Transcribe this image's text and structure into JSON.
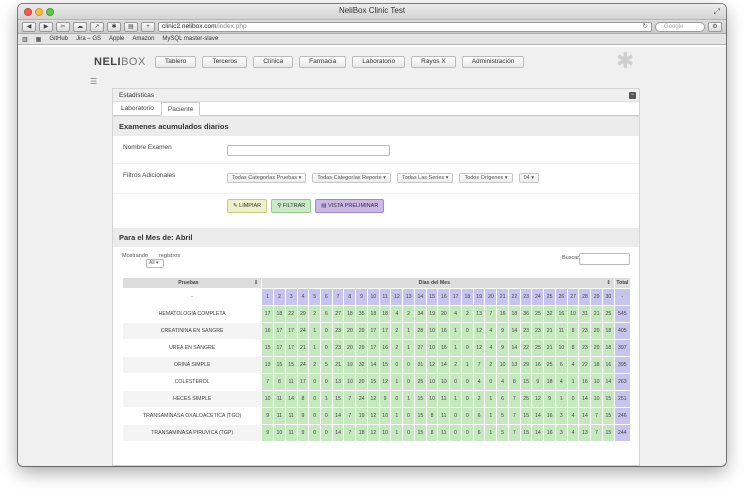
{
  "browser": {
    "window_title": "NeliBox Clinic Test",
    "url_host": "clinic2.nelibox.com",
    "url_path": "/index.php",
    "search_placeholder": "Google",
    "bookmarks": [
      "GitHub",
      "Jira – GS",
      "Apple",
      "Amazon",
      "MySQL master-slave"
    ]
  },
  "app": {
    "logo_main": "NELI",
    "logo_sub": "BOX",
    "nav": [
      "Tablero",
      "Terceros",
      "Clínica",
      "Farmacia",
      "Laboratorio",
      "Rayos X",
      "Administración"
    ]
  },
  "panel": {
    "title": "Estadísticas",
    "tabs": [
      "Laboratorio",
      "Paciente"
    ]
  },
  "form": {
    "section_title": "Examenes acumulados diarios",
    "exam_label": "Nombre Examen",
    "filters_label": "Filtros Adicionales",
    "filters": [
      "Todas Categorías Pruebas",
      "Todas Categorías Reporte",
      "Todas Las Series",
      "Todos Orígenes",
      "04"
    ],
    "btn_clear": "LIMPIAR",
    "btn_filter": "FILTRAR",
    "btn_preview": "VISTA PRELIMINAR"
  },
  "report": {
    "month_title": "Para el Mes de: Abril",
    "show_label": "Mostrando",
    "records_label": "registros",
    "page_len": "All",
    "search_label": "Buscar:",
    "col_tests": "Pruebas",
    "col_days": "Días del Mes",
    "col_total": "Total",
    "days": [
      "1",
      "2",
      "3",
      "4",
      "5",
      "6",
      "7",
      "8",
      "9",
      "10",
      "11",
      "12",
      "13",
      "14",
      "15",
      "16",
      "17",
      "18",
      "19",
      "20",
      "21",
      "22",
      "23",
      "24",
      "25",
      "26",
      "27",
      "28",
      "29",
      "30"
    ],
    "header_row_label": "-",
    "header_row_total": "-",
    "rows": [
      {
        "name": "HEMATOLOGIA COMPLETA",
        "vals": [
          "17",
          "18",
          "22",
          "29",
          "2",
          "6",
          "27",
          "18",
          "35",
          "18",
          "18",
          "4",
          "2",
          "34",
          "19",
          "20",
          "4",
          "2",
          "13",
          "7",
          "16",
          "18",
          "36",
          "25",
          "32",
          "16",
          "10",
          "31",
          "21",
          "25"
        ],
        "total": "545"
      },
      {
        "name": "CREATININA EN SANGRE",
        "vals": [
          "16",
          "17",
          "17",
          "24",
          "1",
          "0",
          "23",
          "20",
          "29",
          "17",
          "17",
          "2",
          "1",
          "28",
          "10",
          "16",
          "1",
          "0",
          "12",
          "4",
          "9",
          "14",
          "23",
          "23",
          "21",
          "11",
          "8",
          "23",
          "20",
          "18"
        ],
        "total": "405"
      },
      {
        "name": "UREA EN SANGRE",
        "vals": [
          "15",
          "17",
          "17",
          "21",
          "1",
          "0",
          "23",
          "20",
          "29",
          "17",
          "16",
          "2",
          "1",
          "27",
          "10",
          "16",
          "1",
          "0",
          "12",
          "4",
          "9",
          "14",
          "22",
          "25",
          "21",
          "10",
          "8",
          "23",
          "20",
          "18"
        ],
        "total": "397"
      },
      {
        "name": "ORINA SIMPLE",
        "vals": [
          "13",
          "15",
          "15",
          "24",
          "2",
          "5",
          "21",
          "19",
          "32",
          "14",
          "15",
          "0",
          "0",
          "31",
          "12",
          "14",
          "2",
          "1",
          "7",
          "2",
          "10",
          "13",
          "29",
          "16",
          "25",
          "6",
          "4",
          "22",
          "18",
          "16"
        ],
        "total": "395"
      },
      {
        "name": "COLESTEROL",
        "vals": [
          "7",
          "8",
          "11",
          "17",
          "0",
          "0",
          "13",
          "10",
          "20",
          "15",
          "12",
          "1",
          "0",
          "25",
          "10",
          "10",
          "0",
          "0",
          "4",
          "0",
          "4",
          "8",
          "15",
          "9",
          "18",
          "4",
          "1",
          "16",
          "10",
          "14"
        ],
        "total": "263"
      },
      {
        "name": "HECES SIMPLE",
        "vals": [
          "10",
          "11",
          "14",
          "8",
          "0",
          "1",
          "15",
          "7",
          "24",
          "12",
          "9",
          "0",
          "1",
          "15",
          "10",
          "11",
          "1",
          "0",
          "2",
          "1",
          "6",
          "7",
          "25",
          "12",
          "9",
          "1",
          "0",
          "14",
          "10",
          "15"
        ],
        "total": "251"
      },
      {
        "name": "TRANSAMINASA OXALOACETICA (TGO)",
        "vals": [
          "9",
          "11",
          "11",
          "9",
          "0",
          "0",
          "14",
          "7",
          "19",
          "12",
          "10",
          "1",
          "0",
          "15",
          "8",
          "11",
          "0",
          "0",
          "6",
          "1",
          "5",
          "7",
          "15",
          "14",
          "16",
          "3",
          "4",
          "14",
          "7",
          "15"
        ],
        "total": "246"
      },
      {
        "name": "TRANSAMINASA PIRUVICA (TGP)",
        "vals": [
          "9",
          "10",
          "11",
          "9",
          "0",
          "0",
          "14",
          "7",
          "18",
          "12",
          "10",
          "1",
          "0",
          "15",
          "8",
          "11",
          "0",
          "0",
          "6",
          "1",
          "5",
          "7",
          "15",
          "14",
          "16",
          "3",
          "4",
          "13",
          "7",
          "15"
        ],
        "total": "244"
      }
    ]
  }
}
